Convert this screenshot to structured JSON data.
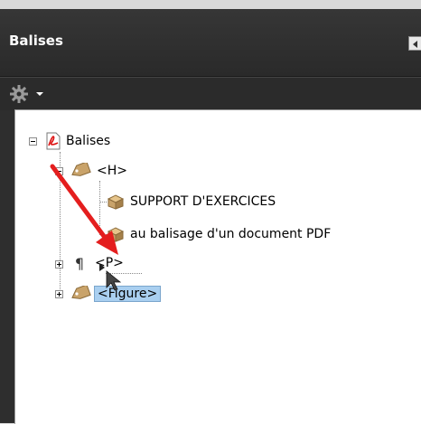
{
  "panel": {
    "title": "Balises",
    "options_icon": "gear-icon",
    "options_menu_icon": "chevron-down-icon",
    "collapse_icon": "triangle-left-icon"
  },
  "tree": {
    "root": {
      "label": "Balises",
      "icon": "pdf-document-icon",
      "expanded": true
    },
    "h_tag": {
      "label": "<H>",
      "icon": "tag-icon",
      "expanded": true
    },
    "content_1": {
      "label": "SUPPORT D'EXERCICES",
      "icon": "content-box-icon"
    },
    "content_2": {
      "label": "au balisage d'un document PDF",
      "icon": "content-box-icon"
    },
    "p_tag": {
      "label": "<P>",
      "icon": "paragraph-icon",
      "expanded": false
    },
    "figure_tag": {
      "label": "<Figure>",
      "icon": "tag-icon",
      "expanded": false,
      "selected": true
    }
  },
  "annotation": {
    "arrow_color": "#e41e1e",
    "cursor": "drag-cursor-icon"
  },
  "colors": {
    "selection": "#a9cff0",
    "panel_bg": "#2e2e2e",
    "tree_bg": "#ffffff"
  }
}
